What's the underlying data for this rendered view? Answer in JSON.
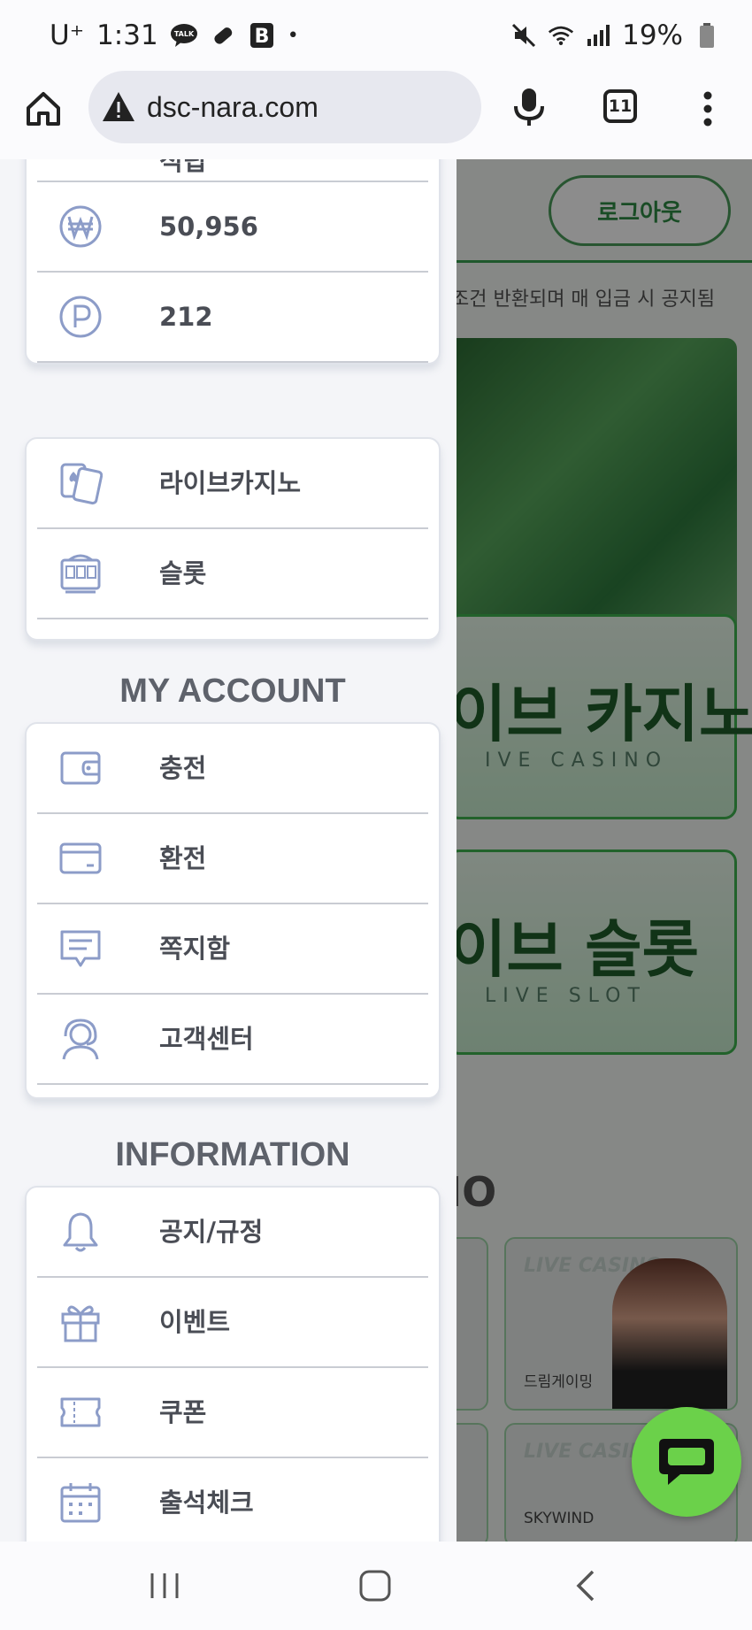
{
  "status_bar": {
    "carrier": "U⁺",
    "time": "1:31",
    "talk_badge": "TALK",
    "b_badge": "B",
    "dot": "•",
    "battery": "19%"
  },
  "browser": {
    "url": "dsc-nara.com",
    "tab_count": "11"
  },
  "background_site": {
    "logout_label": "로그아웃",
    "notice_text": "조건 반환되며 매 입금 시 공지됨",
    "promo_casino_title": "이브 카지노",
    "promo_casino_sub": "IVE CASINO",
    "promo_slot_title": "이브 슬롯",
    "promo_slot_sub": "LIVE SLOT",
    "section_fragment": "IO",
    "card_tag": "LIVE CASINO",
    "card_brand_1": "드림게이밍",
    "card_brand_2": "SKYWIND"
  },
  "drawer": {
    "top_partial_label": "적립",
    "wallet": [
      {
        "icon": "won-icon",
        "label": "50,956"
      },
      {
        "icon": "point-icon",
        "label": "212"
      }
    ],
    "games": [
      {
        "icon": "cards-icon",
        "label": "라이브카지노"
      },
      {
        "icon": "slot-machine-icon",
        "label": "슬롯"
      }
    ],
    "my_account_title": "MY ACCOUNT",
    "my_account": [
      {
        "icon": "wallet-icon",
        "label": "충전"
      },
      {
        "icon": "credit-card-icon",
        "label": "환전"
      },
      {
        "icon": "message-icon",
        "label": "쪽지함"
      },
      {
        "icon": "headset-icon",
        "label": "고객센터"
      }
    ],
    "information_title": "INFORMATION",
    "information": [
      {
        "icon": "bell-icon",
        "label": "공지/규정"
      },
      {
        "icon": "gift-icon",
        "label": "이벤트"
      },
      {
        "icon": "ticket-icon",
        "label": "쿠폰"
      },
      {
        "icon": "calendar-icon",
        "label": "출석체크"
      }
    ]
  },
  "colors": {
    "drawer_icon": "#8c9cc8",
    "accent_green": "#3aa050",
    "chat_fab": "#6bd14a"
  }
}
